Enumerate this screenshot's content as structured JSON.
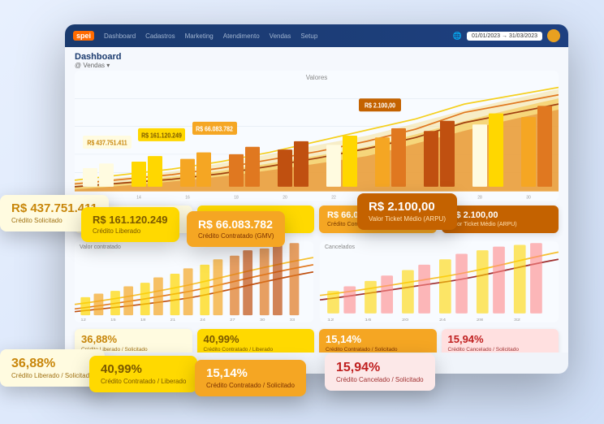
{
  "app": {
    "logo": "spei",
    "nav": {
      "items": [
        "Dashboard",
        "Cadastros",
        "Marketing",
        "Atendimento",
        "Vendas",
        "Setup"
      ]
    },
    "dateRange": "01/01/2023 → 31/03/2023",
    "userAvatar": "user"
  },
  "dashboard": {
    "title": "Dashboard",
    "subtitle": "@ Vendas ▾",
    "chart1_label": "Valores"
  },
  "metrics": {
    "card1_value": "R$ 437.751.411",
    "card1_label": "Crédito Solicitado",
    "card2_value": "R$ 161.120.249",
    "card2_label": "Crédito Liberado",
    "card3_value": "R$ 66.083.782",
    "card3_label": "Crédito Contratado (GMV)",
    "card4_value": "R$ 2.100,00",
    "card4_label": "Valor Ticket Médio (ARPU)"
  },
  "percentages": {
    "p1_value": "36,88%",
    "p1_label": "Crédito Liberado / Solicitado",
    "p2_value": "40,99%",
    "p2_label": "Crédito Contratado / Liberado",
    "p3_value": "15,14%",
    "p3_label": "Crédito Contratado / Solicitado",
    "p4_value": "15,94%",
    "p4_label": "Crédito Cancelado / Solicitado"
  },
  "chart_labels": {
    "valor_contratado": "Valor contratado",
    "cancelados": "Cancelados"
  },
  "icons": {
    "globe": "🌐",
    "calendar": "📅"
  }
}
